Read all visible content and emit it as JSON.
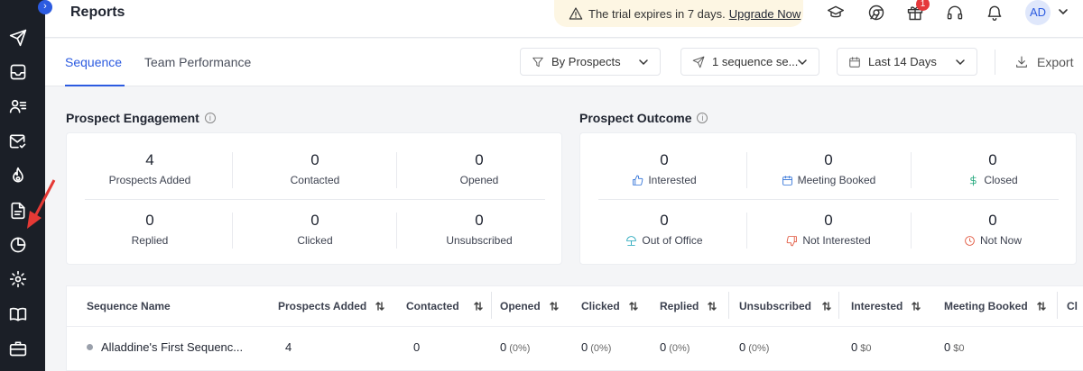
{
  "header": {
    "title": "Reports",
    "trial_text": "The trial expires in 7 days.",
    "upgrade_label": "Upgrade Now",
    "gift_badge": "1",
    "avatar": "AD"
  },
  "tabs": [
    {
      "label": "Sequence",
      "active": true
    },
    {
      "label": "Team Performance",
      "active": false
    }
  ],
  "filters": {
    "prospects": "By Prospects",
    "sequence": "1 sequence se...",
    "date_range": "Last 14 Days",
    "export_label": "Export"
  },
  "engagement": {
    "title": "Prospect Engagement",
    "stats": [
      {
        "value": "4",
        "label": "Prospects Added"
      },
      {
        "value": "0",
        "label": "Contacted"
      },
      {
        "value": "0",
        "label": "Opened"
      },
      {
        "value": "0",
        "label": "Replied"
      },
      {
        "value": "0",
        "label": "Clicked"
      },
      {
        "value": "0",
        "label": "Unsubscribed"
      }
    ]
  },
  "outcome": {
    "title": "Prospect Outcome",
    "stats": [
      {
        "value": "0",
        "label": "Interested",
        "icon": "thumbs-up-icon"
      },
      {
        "value": "0",
        "label": "Meeting Booked",
        "icon": "calendar-icon"
      },
      {
        "value": "0",
        "label": "Closed",
        "icon": "dollar-icon"
      },
      {
        "value": "0",
        "label": "Out of Office",
        "icon": "beach-umbrella-icon"
      },
      {
        "value": "0",
        "label": "Not Interested",
        "icon": "thumbs-down-icon"
      },
      {
        "value": "0",
        "label": "Not Now",
        "icon": "clock-icon"
      }
    ]
  },
  "table": {
    "columns": [
      "Sequence Name",
      "Prospects Added",
      "Contacted",
      "Opened",
      "Clicked",
      "Replied",
      "Unsubscribed",
      "Interested",
      "Meeting Booked",
      "Cl"
    ],
    "rows": [
      {
        "name": "Alladdine's First Sequenc...",
        "prospects_added": "4",
        "contacted": "0",
        "opened": "0",
        "opened_pct": "(0%)",
        "clicked": "0",
        "clicked_pct": "(0%)",
        "replied": "0",
        "replied_pct": "(0%)",
        "unsubscribed": "0",
        "unsubscribed_pct": "(0%)",
        "interested": "0",
        "interested_amt": "$0",
        "meeting_booked": "0",
        "meeting_booked_amt": "$0"
      }
    ]
  },
  "colors": {
    "accent": "#2c5be0",
    "sidebar": "#1b1f27",
    "trial_bg": "#fdf6e3",
    "badge": "#e5383b",
    "annotation_arrow": "#e53935"
  }
}
